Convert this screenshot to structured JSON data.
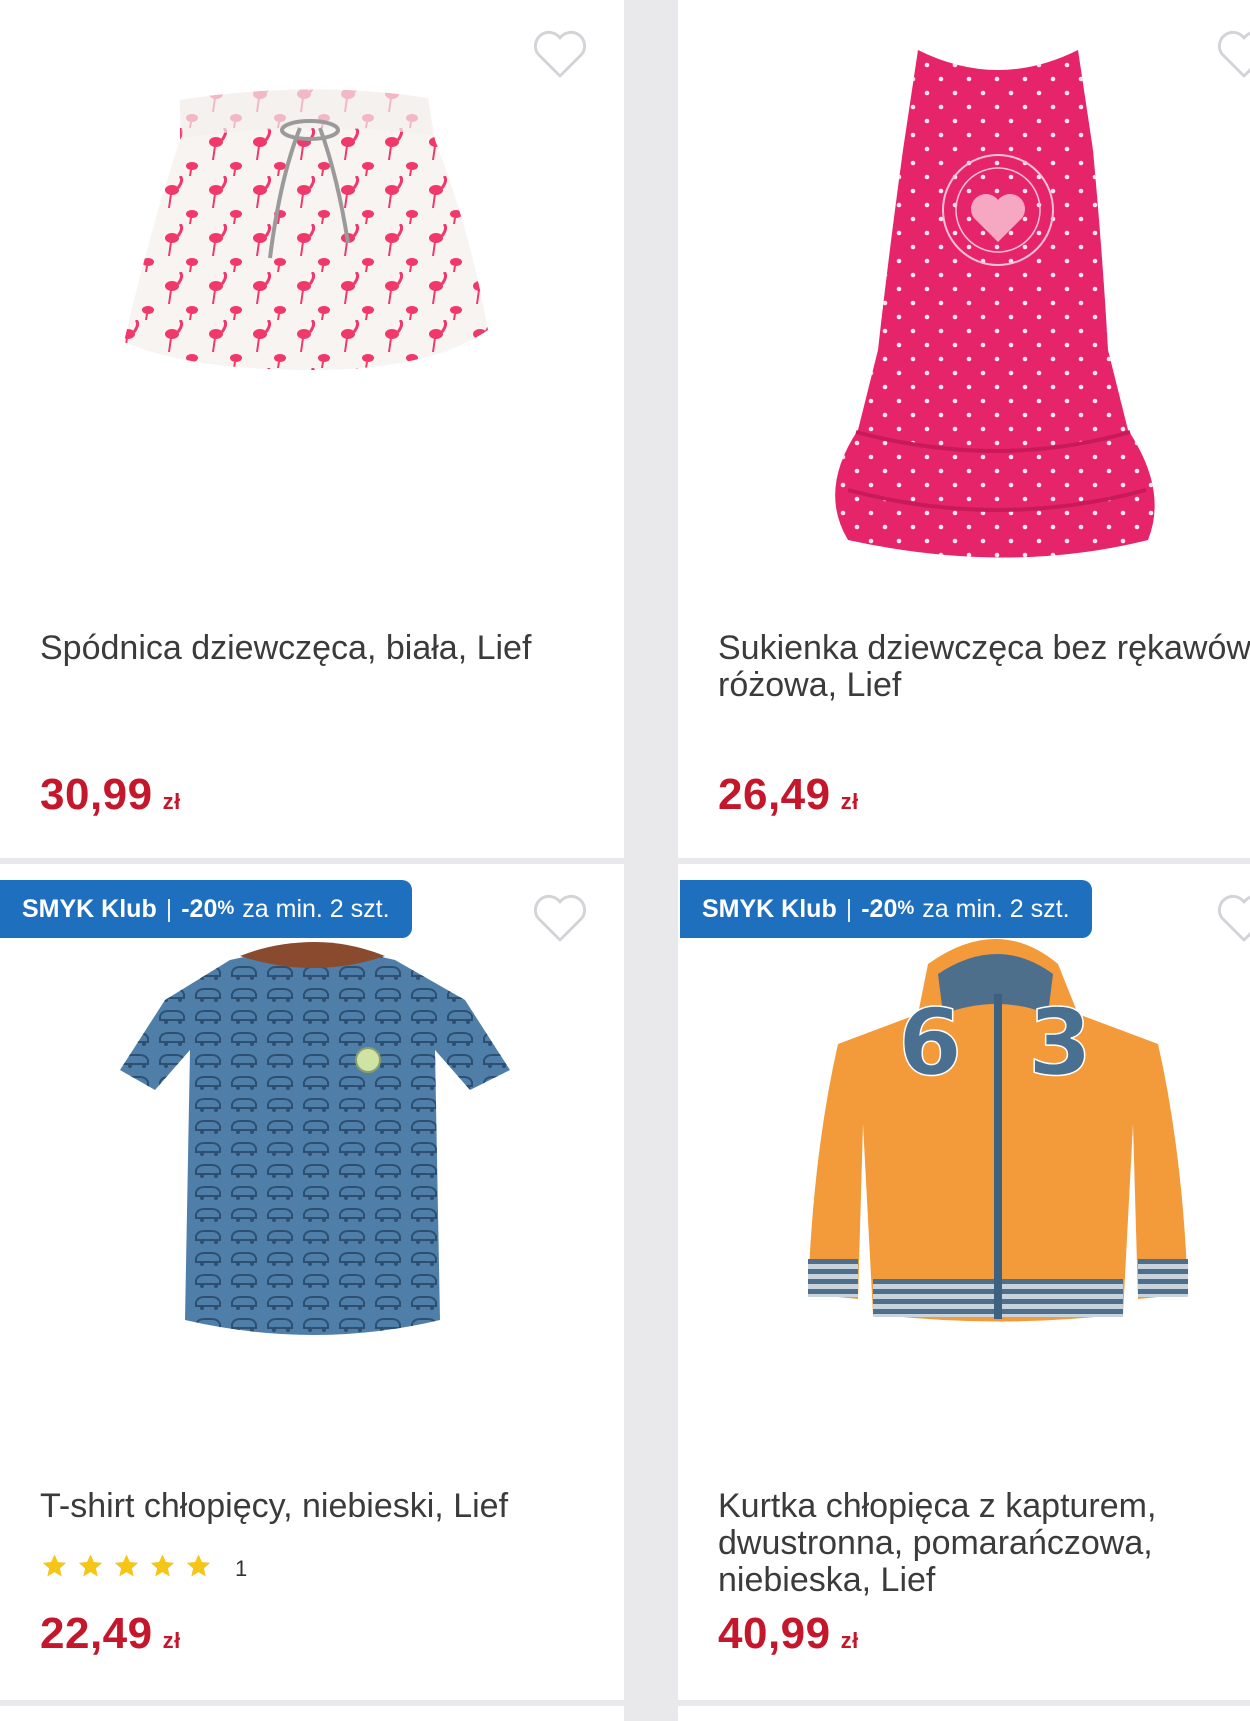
{
  "products": [
    {
      "title": "Spódnica dziewczęca, biała, Lief",
      "price": "30,99",
      "currency": "zł"
    },
    {
      "title": "Sukienka dziewczęca bez rękawów, różowa, Lief",
      "price": "26,49",
      "currency": "zł"
    },
    {
      "badge": {
        "brand": "SMYK Klub",
        "sep": "|",
        "discount": "-20",
        "percent": "%",
        "condition": "za min. 2 szt."
      },
      "title": "T-shirt chłopięcy, niebieski, Lief",
      "rating_count": "1",
      "rating_stars": 5,
      "price": "22,49",
      "currency": "zł"
    },
    {
      "badge": {
        "brand": "SMYK Klub",
        "sep": "|",
        "discount": "-20",
        "percent": "%",
        "condition": "za min. 2 szt."
      },
      "title": "Kurtka chłopięca z kapturem, dwustronna, pomarańczowa, niebieska, Lief",
      "price": "40,99",
      "currency": "zł"
    }
  ],
  "icons": {
    "wishlist": "heart-outline-icon",
    "star": "star-icon"
  },
  "colors": {
    "price": "#c4172c",
    "badge": "#1f6fbf",
    "star": "#f5c518"
  }
}
